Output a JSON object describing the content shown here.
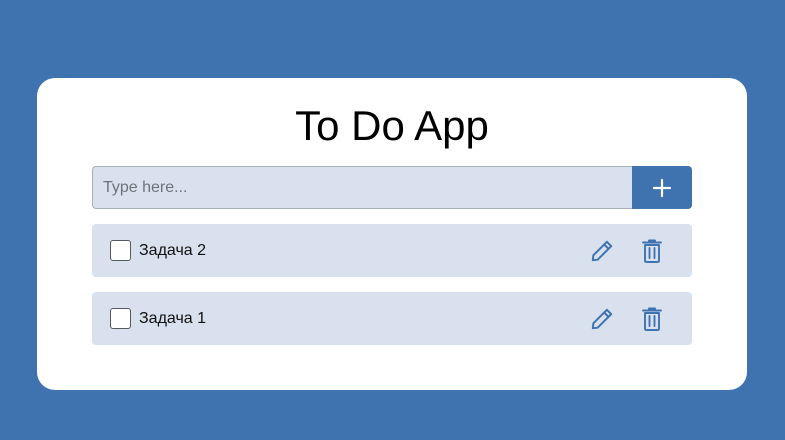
{
  "app": {
    "title": "To Do App"
  },
  "input": {
    "placeholder": "Type here...",
    "value": ""
  },
  "add_button": {
    "icon": "plus-icon"
  },
  "tasks": [
    {
      "label": "Задача 2",
      "checked": false,
      "edit_icon": "pencil-icon",
      "delete_icon": "trash-icon"
    },
    {
      "label": "Задача 1",
      "checked": false,
      "edit_icon": "pencil-icon",
      "delete_icon": "trash-icon"
    }
  ],
  "colors": {
    "background": "#3f73b0",
    "card": "#ffffff",
    "accent": "#3f73b0",
    "item_background": "#d9e1ee"
  }
}
